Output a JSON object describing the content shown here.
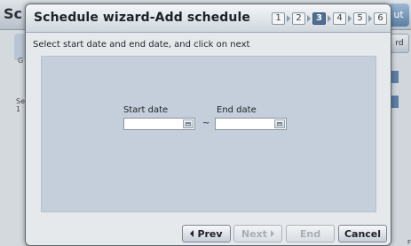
{
  "background": {
    "title_fragment": "Sc",
    "exit_fragment": "ut",
    "right_button_fragment": "rd",
    "left_label_g": "G",
    "left_label_s": "Se",
    "left_label_s2": "1",
    "bottom_fragment": "F"
  },
  "dialog": {
    "title": "Schedule wizard-Add schedule",
    "instruction": "Select start date and end date, and click on next",
    "steps": [
      {
        "label": "1",
        "active": false
      },
      {
        "label": "2",
        "active": false
      },
      {
        "label": "3",
        "active": true
      },
      {
        "label": "4",
        "active": false
      },
      {
        "label": "5",
        "active": false
      },
      {
        "label": "6",
        "active": false
      }
    ],
    "start_date": {
      "label": "Start date",
      "value": ""
    },
    "end_date": {
      "label": "End date",
      "value": ""
    },
    "range_separator": "~",
    "buttons": {
      "prev": "Prev",
      "next": "Next",
      "end": "End",
      "cancel": "Cancel"
    },
    "icons": [
      "calendar-icon",
      "chevron-left-icon",
      "chevron-right-icon"
    ],
    "colors": {
      "active_step": "#4f6f92",
      "panel": "#c4cfdb"
    }
  }
}
